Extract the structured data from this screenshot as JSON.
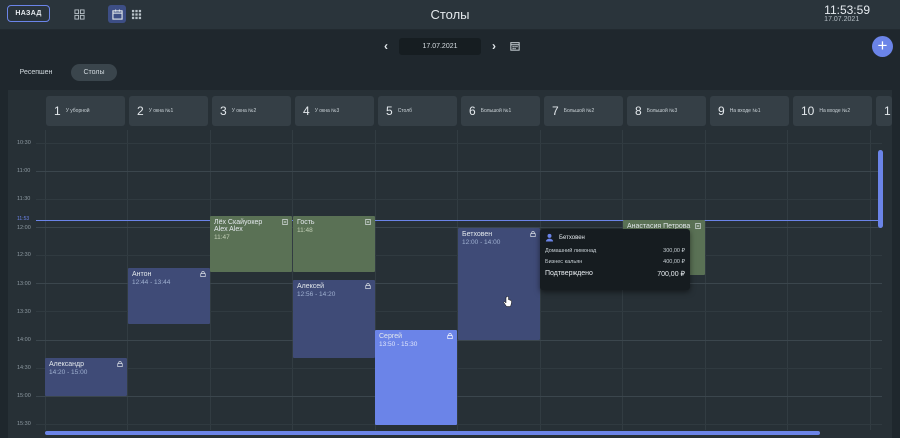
{
  "header": {
    "back_label": "НАЗАД",
    "title": "Столы",
    "time": "11:53:59",
    "date": "17.07.2021",
    "accent": "#6b84e8"
  },
  "date_nav": {
    "date": "17.07.2021",
    "prev": "‹",
    "next": "›"
  },
  "tabs": [
    {
      "label": "Ресепшен",
      "active": false
    },
    {
      "label": "Столы",
      "active": true
    }
  ],
  "tables": [
    {
      "num": "1",
      "name": "У уборной"
    },
    {
      "num": "2",
      "name": "У окна №1"
    },
    {
      "num": "3",
      "name": "У окна №2"
    },
    {
      "num": "4",
      "name": "У окна №3"
    },
    {
      "num": "5",
      "name": "Столб"
    },
    {
      "num": "6",
      "name": "Большой №1"
    },
    {
      "num": "7",
      "name": "Большой №2"
    },
    {
      "num": "8",
      "name": "Большой №3"
    },
    {
      "num": "9",
      "name": "На входе №1"
    },
    {
      "num": "10",
      "name": "На входе №2"
    },
    {
      "num": "1",
      "name": ""
    }
  ],
  "time_labels": [
    "10:30",
    "11:00",
    "11:30",
    "12:00",
    "12:30",
    "13:00",
    "13:30",
    "14:00",
    "14:30",
    "15:00",
    "15:30"
  ],
  "now_label": "11:53",
  "reservations": [
    {
      "name": "Лёх Скайуокер",
      "name2": "Alex Alex",
      "time": "11:47",
      "color": "green"
    },
    {
      "name": "Гость",
      "name2": "",
      "time": "11:48",
      "color": "green"
    },
    {
      "name": "Антон",
      "name2": "",
      "time": "12:44 - 13:44",
      "color": "blue"
    },
    {
      "name": "Алексей",
      "name2": "",
      "time": "12:56 - 14:20",
      "color": "blue"
    },
    {
      "name": "Бетховен",
      "name2": "",
      "time": "12:00 - 14:00",
      "color": "blue"
    },
    {
      "name": "Сергей",
      "name2": "",
      "time": "13:50 - 15:30",
      "color": "bright"
    },
    {
      "name": "Александр",
      "name2": "",
      "time": "14:20 - 15:00",
      "color": "blue"
    },
    {
      "name": "Анастасия Петрова",
      "name2": "",
      "time": "",
      "color": "green"
    }
  ],
  "popup": {
    "guest": "Бетховен",
    "items": [
      {
        "name": "Домашний лимонад",
        "price": "300,00 ₽"
      },
      {
        "name": "Бизнес кальян",
        "price": "400,00 ₽"
      }
    ],
    "status": "Подтверждено",
    "total": "700,00 ₽"
  }
}
